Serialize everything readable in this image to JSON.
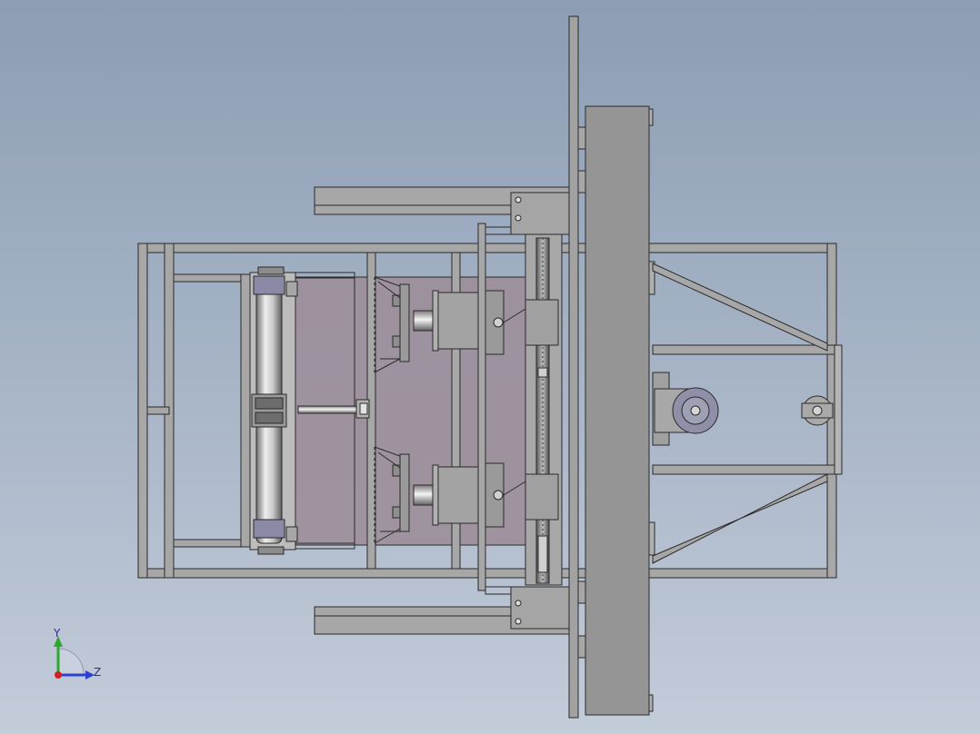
{
  "viewport": {
    "background_top": "#8c9db4",
    "background_bottom": "#c3ccd9"
  },
  "triad": {
    "y_label": "Y",
    "z_label": "Z",
    "y_color": "#2fa82f",
    "z_color": "#2b3fd0",
    "x_color": "#d02020"
  },
  "model": {
    "edge_color": "#2a2a2a",
    "frame_fill": "#a7a7a7",
    "plate_fill": "#9c8e9a",
    "motor_fill": "#959595"
  }
}
